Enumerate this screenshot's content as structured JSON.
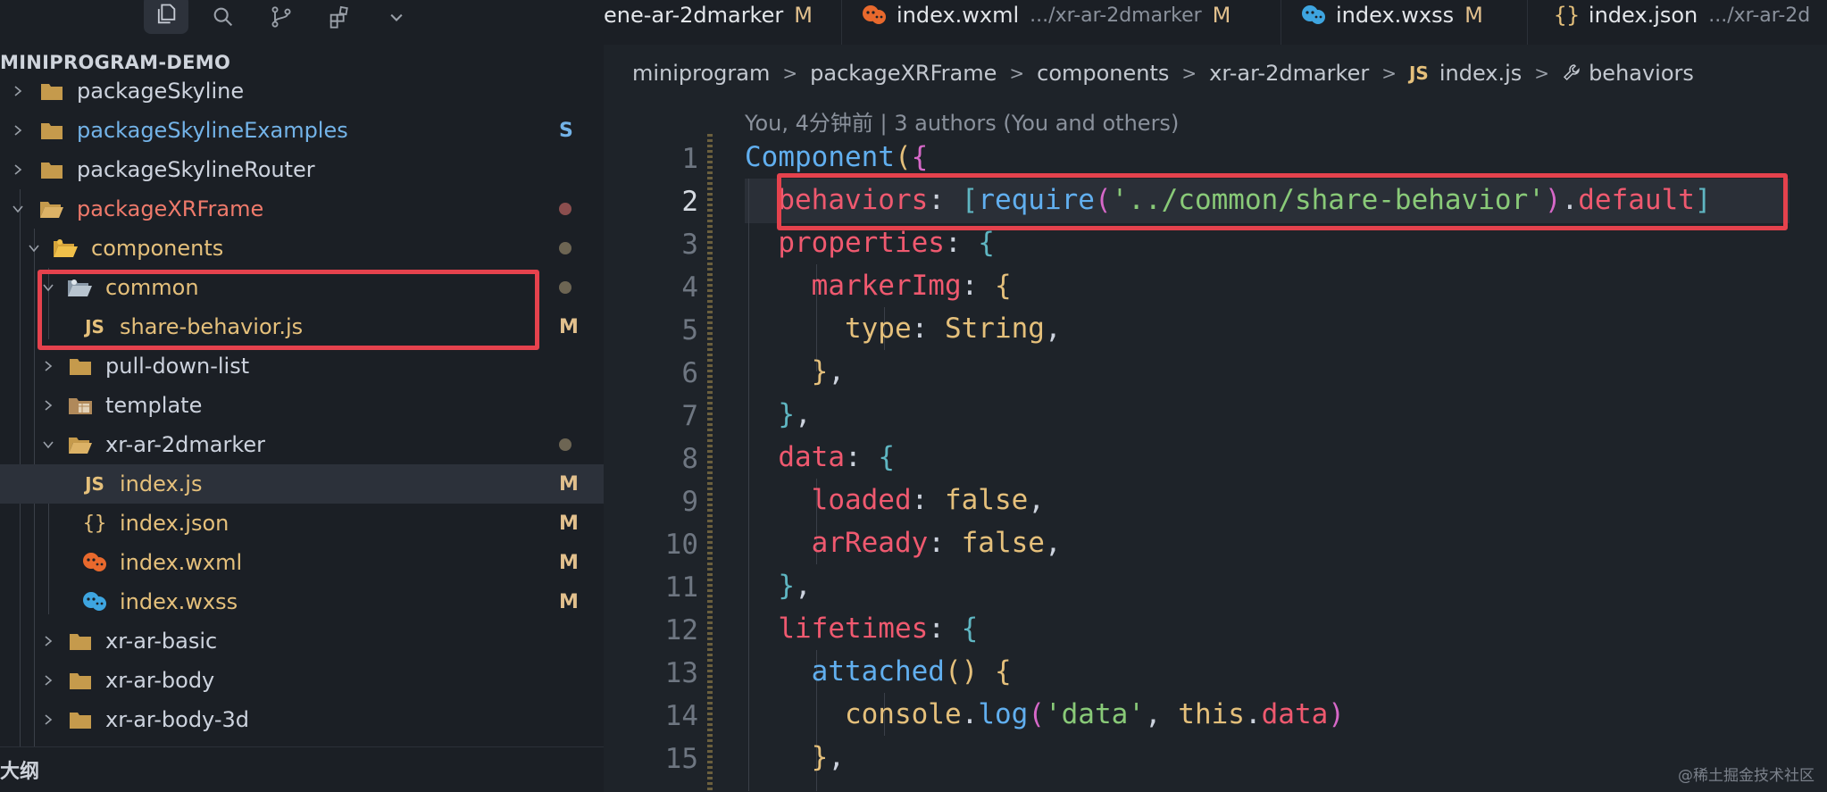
{
  "activity": {
    "icons": [
      "explorer-icon",
      "search-icon",
      "source-control-icon",
      "extensions-icon",
      "chevron-down-icon"
    ]
  },
  "tabs": [
    {
      "label": "ene-ar-2dmarker",
      "desc": "",
      "mod": "M",
      "icon": "none"
    },
    {
      "label": "index.wxml",
      "desc": ".../xr-ar-2dmarker",
      "mod": "M",
      "icon": "wxml-icon"
    },
    {
      "label": "index.wxss",
      "desc": "",
      "mod": "M",
      "icon": "wxss-icon"
    },
    {
      "label": "index.json",
      "desc": ".../xr-ar-2d",
      "mod": "",
      "icon": "json-icon"
    }
  ],
  "sidebar": {
    "title": "MINIPROGRAM-DEMO",
    "outline_label": "大纲",
    "items": [
      {
        "label": "packageSkyline",
        "status": ""
      },
      {
        "label": "packageSkylineExamples",
        "status": "S"
      },
      {
        "label": "packageSkylineRouter",
        "status": ""
      },
      {
        "label": "packageXRFrame",
        "status": ""
      },
      {
        "label": "components",
        "status": ""
      },
      {
        "label": "common",
        "status": ""
      },
      {
        "label": "share-behavior.js",
        "status": "M"
      },
      {
        "label": "pull-down-list",
        "status": ""
      },
      {
        "label": "template",
        "status": ""
      },
      {
        "label": "xr-ar-2dmarker",
        "status": ""
      },
      {
        "label": "index.js",
        "status": "M"
      },
      {
        "label": "index.json",
        "status": "M"
      },
      {
        "label": "index.wxml",
        "status": "M"
      },
      {
        "label": "index.wxss",
        "status": "M"
      },
      {
        "label": "xr-ar-basic",
        "status": ""
      },
      {
        "label": "xr-ar-body",
        "status": ""
      },
      {
        "label": "xr-ar-body-3d",
        "status": ""
      }
    ]
  },
  "breadcrumb": {
    "items": [
      "miniprogram",
      "packageXRFrame",
      "components",
      "xr-ar-2dmarker",
      "index.js",
      "behaviors"
    ],
    "js_badge": "JS"
  },
  "blame": "You, 4分钟前 | 3 authors (You and others)",
  "line_numbers": [
    "1",
    "2",
    "3",
    "4",
    "5",
    "6",
    "7",
    "8",
    "9",
    "10",
    "11",
    "12",
    "13",
    "14",
    "15"
  ],
  "code": {
    "l1_fn": "Component",
    "l2_key": "behaviors",
    "l2_fn": "require",
    "l2_str": "'../common/share-behavior'",
    "l2_prop": "default",
    "l3_key": "properties",
    "l4_key": "markerImg",
    "l5_key": "type",
    "l5_val": "String",
    "l8_key": "data",
    "l9_key": "loaded",
    "l9_val": "false",
    "l10_key": "arReady",
    "l10_val": "false",
    "l12_key": "lifetimes",
    "l13_fn": "attached",
    "l14_obj": "console",
    "l14_fn": "log",
    "l14_str": "'data'",
    "l14_this": "this",
    "l14_prop": "data"
  },
  "watermark": "@稀土掘金技术社区",
  "colors": {
    "highlight": "#e5424d",
    "modified": "#e2c08d",
    "accent_red": "#ef596f"
  }
}
